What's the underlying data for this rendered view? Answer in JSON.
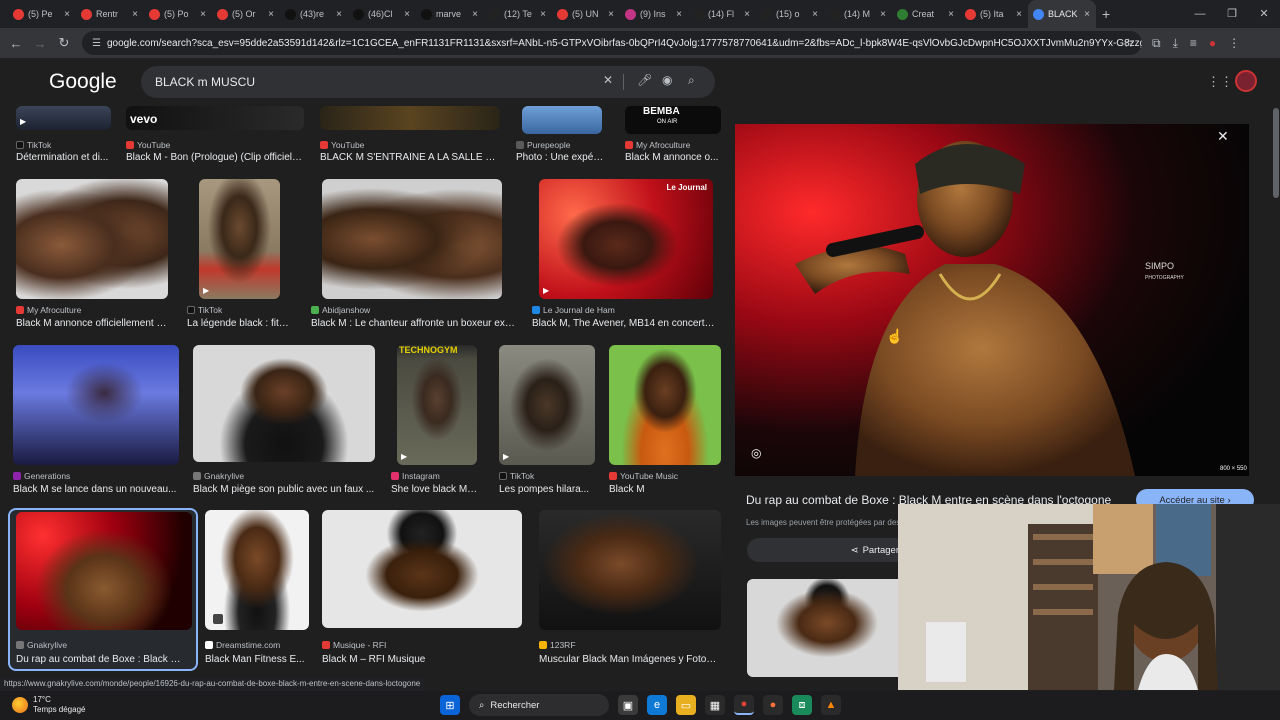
{
  "tabs": [
    {
      "label": "(5) Pe",
      "color": "#e53935"
    },
    {
      "label": "Rentr",
      "color": "#e53935"
    },
    {
      "label": "(5) Po",
      "color": "#e53935"
    },
    {
      "label": "(5) Or",
      "color": "#e53935"
    },
    {
      "label": "(43)re",
      "color": "#111111"
    },
    {
      "label": "(46)Cl",
      "color": "#111111"
    },
    {
      "label": "marve",
      "color": "#111111"
    },
    {
      "label": "(12) Te",
      "color": "#222222"
    },
    {
      "label": "(5) UN",
      "color": "#e53935"
    },
    {
      "label": "(9) Ins",
      "color": "#c13584"
    },
    {
      "label": "(14) Fl",
      "color": "#222222"
    },
    {
      "label": "(15) o",
      "color": "#222222"
    },
    {
      "label": "(14) M",
      "color": "#222222"
    },
    {
      "label": "Creat",
      "color": "#2e7d32"
    },
    {
      "label": "(5) Ita",
      "color": "#e53935"
    },
    {
      "label": "BLACK",
      "color": "#4285f4"
    }
  ],
  "window": {
    "min": "—",
    "max": "❐",
    "close": "✕"
  },
  "address": {
    "url": "google.com/search?sca_esv=95dde2a53591d142&rlz=1C1GCEA_enFR1131FR1131&sxsrf=ANbL-n5-GTPxVOibrfas-0bQPrI4QvJolg:1777578770641&udm=2&fbs=ADc_l-bpk8W4E-qsVlOvbGJcDwpnHC5OJXXTJvmMu2n9YYx-G8zzgQk24aW1N_Fy..."
  },
  "google": {
    "logo": "Google",
    "query": "BLACK m MUSCU"
  },
  "row0": [
    {
      "source": "TikTok",
      "title": "Détermination et di..."
    },
    {
      "source": "YouTube",
      "title": "Black M - Bon (Prologue) (Clip officiel) ..."
    },
    {
      "source": "YouTube",
      "title": "BLACK M S'ENTRAÎNE A LA SALLE D..."
    },
    {
      "source": "Purepeople",
      "title": "Photo : Une expéri..."
    },
    {
      "source": "My Afroculture",
      "title": "Black M annonce o..."
    }
  ],
  "row0_badges": {
    "vevo": "vevo",
    "bemba": "BEMBA",
    "onair": "ON AIR"
  },
  "row1": [
    {
      "source": "My Afroculture",
      "title": "Black M annonce officiellement s..."
    },
    {
      "source": "TikTok",
      "title": "La légende black : fitn..."
    },
    {
      "source": "Abidjanshow",
      "title": "Black M : Le chanteur affronte un boxeur exp..."
    },
    {
      "source": "Le Journal de Ham",
      "title": "Black M, The Avener, MB14 en concert g..."
    }
  ],
  "row1_badge": "Le Journal",
  "row2": [
    {
      "source": "Generations",
      "title": "Black M se lance dans un nouveau..."
    },
    {
      "source": "Gnakrylive",
      "title": "Black M piège son public avec un faux ..."
    },
    {
      "source": "Instagram",
      "title": "She love black Me..."
    },
    {
      "source": "TikTok",
      "title": "Les pompes hilara..."
    },
    {
      "source": "YouTube Music",
      "title": "Black M"
    }
  ],
  "row2_badge": "TECHNOGYM",
  "row3": [
    {
      "source": "Gnakrylive",
      "title": "Du rap au combat de Boxe : Black M ..."
    },
    {
      "source": "Dreamstime.com",
      "title": "Black Man Fitness E..."
    },
    {
      "source": "Musique - RFI",
      "title": "Black M – RFI Musique"
    },
    {
      "source": "123RF",
      "title": "Muscular Black Man Imágenes y Fotos ..."
    }
  ],
  "panel": {
    "title": "Du rap au combat de Boxe : Black M entre en scène dans l'octogone",
    "visit": "Accéder au site",
    "protect": "Les images peuvent être protégées par des",
    "share": "Partager",
    "watermark": "SIMPO",
    "watermark2": "PHOTOGRAPHY",
    "dims": "800 × 550"
  },
  "status_url": "https://www.gnakrylive.com/monde/people/16926-du-rap-au-combat-de-boxe-black-m-entre-en-scene-dans-loctogone",
  "taskbar": {
    "temp": "17°C",
    "weather": "Temps dégagé",
    "search": "Rechercher"
  }
}
